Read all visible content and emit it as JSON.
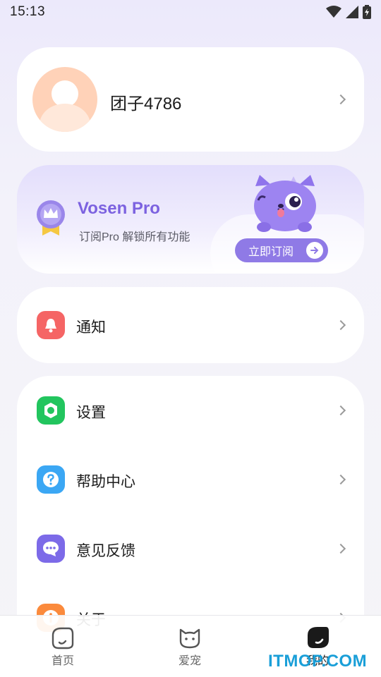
{
  "status_bar": {
    "time": "15:13"
  },
  "profile": {
    "name": "团子4786"
  },
  "pro": {
    "title": "Vosen Pro",
    "subtitle": "订阅Pro 解锁所有功能",
    "button_label": "立即订阅"
  },
  "menu": {
    "notifications": {
      "label": "通知",
      "icon": "bell-icon",
      "color": "#f56565"
    },
    "items": [
      {
        "label": "设置",
        "icon": "settings-icon",
        "color": "#22c55e"
      },
      {
        "label": "帮助中心",
        "icon": "help-icon",
        "color": "#3ba7f4"
      },
      {
        "label": "意见反馈",
        "icon": "feedback-icon",
        "color": "#7c6ae8"
      },
      {
        "label": "关于",
        "icon": "info-icon",
        "color": "#fb8a3c"
      }
    ]
  },
  "bottom_nav": {
    "items": [
      {
        "label": "首页",
        "icon": "home-icon"
      },
      {
        "label": "爱宠",
        "icon": "pet-icon"
      },
      {
        "label": "我的",
        "icon": "profile-icon",
        "active": true
      }
    ]
  },
  "watermark": "ITMOP.COM"
}
